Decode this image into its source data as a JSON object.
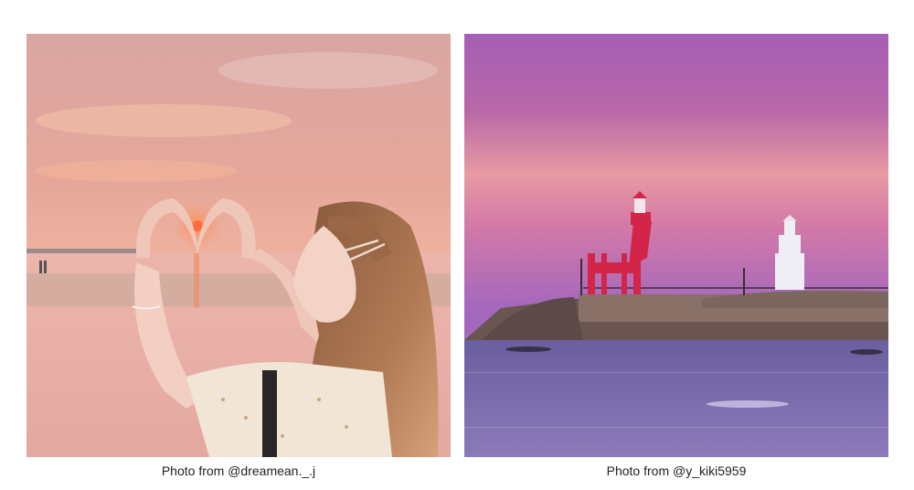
{
  "photos": [
    {
      "caption": "Photo from @dreamean._.j",
      "subject": "woman making heart shape with hands around sunset on beach"
    },
    {
      "caption": "Photo from @y_kiki5959",
      "subject": "red horse-shaped lighthouse and white lighthouse on breakwater at dusk"
    }
  ]
}
